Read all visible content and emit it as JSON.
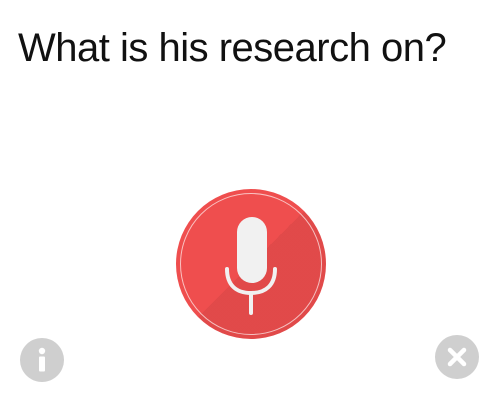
{
  "query": {
    "text": "What is his research on?"
  },
  "colors": {
    "mic_background": "#ef4e4e",
    "mic_glyph": "#f1f1f1",
    "secondary_button": "#cfcfcf",
    "text": "#111111"
  },
  "icons": {
    "mic": "microphone-icon",
    "info": "info-icon",
    "close": "close-icon"
  }
}
